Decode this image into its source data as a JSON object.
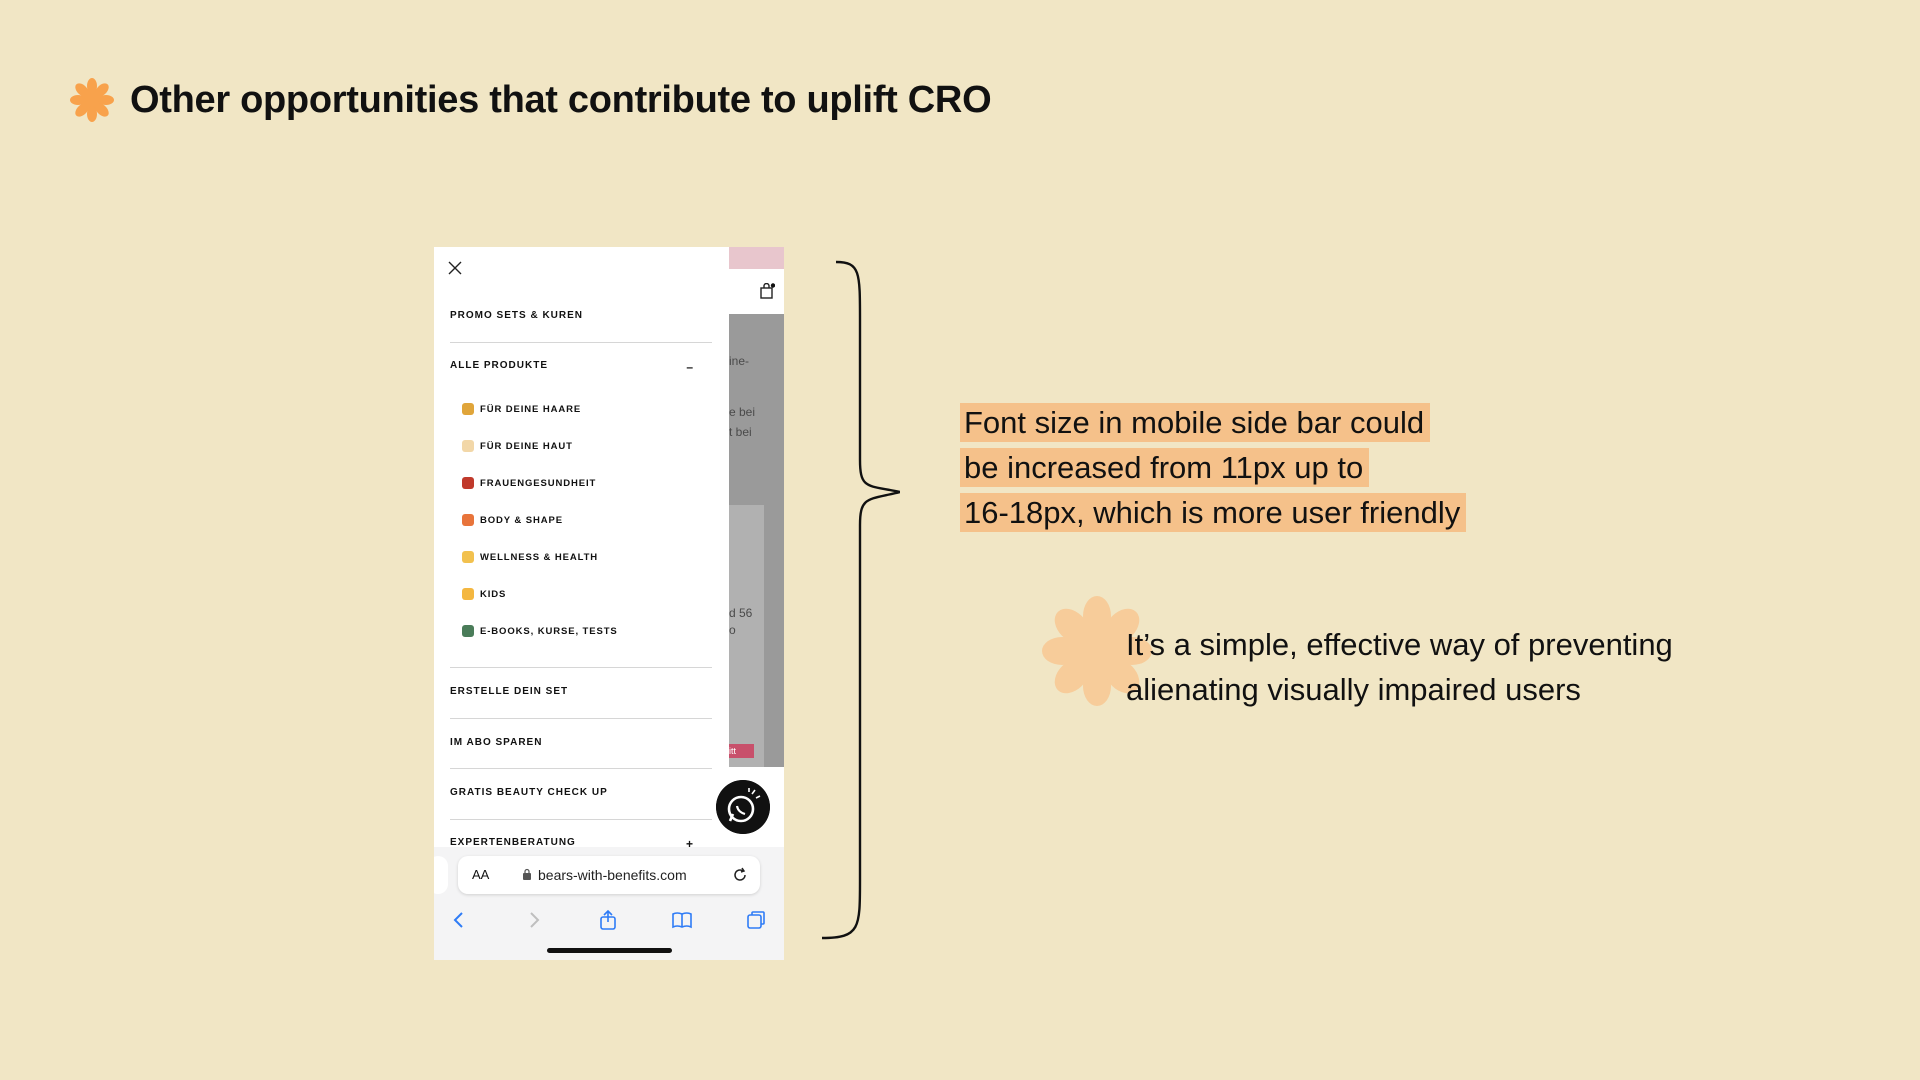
{
  "slide": {
    "title": "Other opportunities that contribute to uplift CRO",
    "bullet_icon": "flower-icon",
    "accent_color": "#F8A24C",
    "background_color": "#F1E6C5",
    "highlight_color": "#F5C18A"
  },
  "phone": {
    "close_icon": "close-icon",
    "menu": {
      "promo": "PROMO SETS & KUREN",
      "alle": "ALLE PRODUKTE",
      "alle_toggle": "–",
      "sub_items": [
        {
          "label": "FÜR DEINE HAARE",
          "emoji_color": "#E0A53A"
        },
        {
          "label": "FÜR DEINE HAUT",
          "emoji_color": "#F2D7A8"
        },
        {
          "label": "FRAUENGESUNDHEIT",
          "emoji_color": "#C0392B"
        },
        {
          "label": "BODY & SHAPE",
          "emoji_color": "#E8743B"
        },
        {
          "label": "WELLNESS & HEALTH",
          "emoji_color": "#F2C14E"
        },
        {
          "label": "KIDS",
          "emoji_color": "#F4B740"
        },
        {
          "label": "E-BOOKS, KURSE, TESTS",
          "emoji_color": "#4A7C59"
        }
      ],
      "erstelle": "ERSTELLE DEIN SET",
      "abo": "IM ABO SPAREN",
      "gratis": "GRATIS BEAUTY CHECK UP",
      "experten": "EXPERTENBERATUNG",
      "experten_toggle": "+"
    },
    "background_fragments": {
      "frag1": "ine-",
      "frag2": "e bei",
      "frag3": "t bei",
      "frag4": "d 56",
      "frag5": "o",
      "badge": "itt"
    },
    "browser": {
      "aa": "AA",
      "url": "bears-with-benefits.com"
    }
  },
  "callout": {
    "line1": "Font size in mobile side bar could",
    "line2": "be increased from 11px up to",
    "line3": "16-18px, which is more user friendly",
    "note_line1": "It’s a simple, effective way of preventing",
    "note_line2": "alienating visually impaired users"
  }
}
